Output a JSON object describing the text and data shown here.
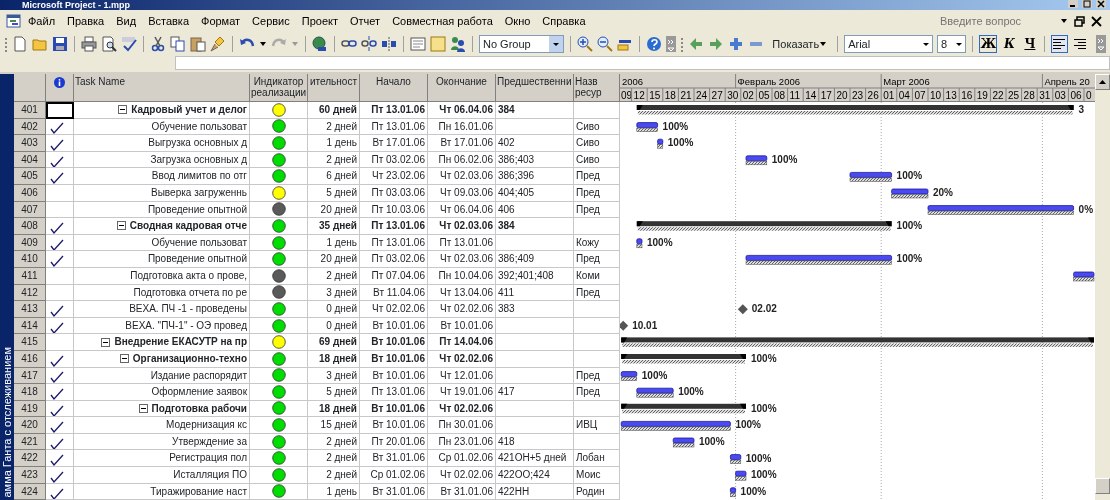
{
  "window": {
    "title": "Microsoft Project - 1.mpp"
  },
  "menu": [
    "Файл",
    "Правка",
    "Вид",
    "Вставка",
    "Формат",
    "Сервис",
    "Проект",
    "Отчет",
    "Совместная работа",
    "Окно",
    "Справка"
  ],
  "help_search": {
    "placeholder": "Введите вопрос"
  },
  "toolbar": {
    "group": "No Group",
    "show_menu": "Показать",
    "font": "Arial",
    "font_size": "8",
    "format_buttons": [
      {
        "label": "Ж",
        "selected": true
      },
      {
        "label": "К",
        "selected": false
      },
      {
        "label": "Ч",
        "selected": false
      }
    ],
    "align_buttons": [
      {
        "selected": true
      },
      {
        "selected": false
      }
    ]
  },
  "view_bar": {
    "label": "амма Ганта с отслеживанием"
  },
  "table": {
    "columns": [
      "Task Name",
      "Индикатор реализации",
      "ительност",
      "Начало",
      "Окончание",
      "Предшественни",
      "Назв ресур"
    ],
    "rows": [
      {
        "id": "401",
        "name": "Кадровый учет и делог",
        "kind": "summary",
        "expanded": true,
        "done": false,
        "selected": true,
        "color": "#ffff00",
        "duration": "60 дней",
        "start": "Пт 13.01.06",
        "finish": "Чт 06.04.06",
        "predecessors": "384",
        "bar_label": "3"
      },
      {
        "id": "402",
        "name": "Обучение пользоват",
        "kind": "task",
        "done": true,
        "selected": false,
        "color": "#00dd00",
        "duration": "2 дней",
        "start": "Пт 13.01.06",
        "finish": "Пн 16.01.06",
        "resource": "Сиво",
        "bar_label": "100%"
      },
      {
        "id": "403",
        "name": "Выгрузка основных д",
        "kind": "task",
        "done": true,
        "selected": false,
        "color": "#00dd00",
        "duration": "1 день",
        "start": "Вт 17.01.06",
        "finish": "Вт 17.01.06",
        "predecessors": "402",
        "resource": "Сиво",
        "bar_label": "100%"
      },
      {
        "id": "404",
        "name": "Загрузка основных д",
        "kind": "task",
        "done": true,
        "selected": false,
        "color": "#00dd00",
        "duration": "2 дней",
        "start": "Пт 03.02.06",
        "finish": "Пн 06.02.06",
        "predecessors": "386;403",
        "resource": "Сиво",
        "bar_label": "100%"
      },
      {
        "id": "405",
        "name": "Ввод лимитов по отг",
        "kind": "task",
        "done": true,
        "selected": false,
        "color": "#00dd00",
        "duration": "6 дней",
        "start": "Чт 23.02.06",
        "finish": "Чт 02.03.06",
        "predecessors": "386;396",
        "resource": "Пред",
        "bar_label": "100%"
      },
      {
        "id": "406",
        "name": "Выверка загруженнь",
        "kind": "task",
        "done": false,
        "selected": false,
        "color": "#ffff00",
        "duration": "5 дней",
        "start": "Пт 03.03.06",
        "finish": "Чт 09.03.06",
        "predecessors": "404;405",
        "resource": "Пред",
        "bar_label": "20%"
      },
      {
        "id": "407",
        "name": "Проведение опытной",
        "kind": "task",
        "done": false,
        "selected": false,
        "color": "#5a5a5a",
        "duration": "20 дней",
        "start": "Пт 10.03.06",
        "finish": "Чт 06.04.06",
        "predecessors": "406",
        "resource": "Пред",
        "bar_label": "0%"
      },
      {
        "id": "408",
        "name": "Сводная кадровая отче",
        "kind": "summary",
        "expanded": true,
        "done": true,
        "selected": false,
        "color": "#00dd00",
        "duration": "35 дней",
        "start": "Пт 13.01.06",
        "finish": "Чт 02.03.06",
        "predecessors": "384",
        "bar_label": "100%"
      },
      {
        "id": "409",
        "name": "Обучение пользоват",
        "kind": "task",
        "done": true,
        "selected": false,
        "color": "#00dd00",
        "duration": "1 день",
        "start": "Пт 13.01.06",
        "finish": "Пт 13.01.06",
        "resource": "Кожу",
        "bar_label": "100%"
      },
      {
        "id": "410",
        "name": "Проведение опытной",
        "kind": "task",
        "done": true,
        "selected": false,
        "color": "#00dd00",
        "duration": "20 дней",
        "start": "Пт 03.02.06",
        "finish": "Чт 02.03.06",
        "predecessors": "386;409",
        "resource": "Пред",
        "bar_label": "100%"
      },
      {
        "id": "411",
        "name": "Подготовка акта о прове,",
        "kind": "task",
        "done": false,
        "selected": false,
        "color": "#5a5a5a",
        "duration": "2 дней",
        "start": "Пт 07.04.06",
        "finish": "Пн 10.04.06",
        "predecessors": "392;401;408",
        "resource": "Коми"
      },
      {
        "id": "412",
        "name": "Подготовка отчета по ре",
        "kind": "task",
        "done": false,
        "selected": false,
        "color": "#5a5a5a",
        "duration": "3 дней",
        "start": "Вт 11.04.06",
        "finish": "Чт 13.04.06",
        "predecessors": "411",
        "resource": "Пред"
      },
      {
        "id": "413",
        "name": "ВЕХА. ПЧ -1 - проведены",
        "kind": "milestone",
        "done": true,
        "selected": false,
        "color": "#00dd00",
        "duration": "0 дней",
        "start": "Чт 02.02.06",
        "finish": "Чт 02.02.06",
        "predecessors": "383",
        "bar_label": "02.02"
      },
      {
        "id": "414",
        "name": "ВЕХА. \"ПЧ-1\" - ОЭ провед",
        "kind": "milestone",
        "done": true,
        "selected": false,
        "color": "#00dd00",
        "duration": "0 дней",
        "start": "Вт 10.01.06",
        "finish": "Вт 10.01.06",
        "bar_label": "10.01"
      },
      {
        "id": "415",
        "name": "Внедрение ЕКАСУТР на пр",
        "kind": "summary",
        "expanded": true,
        "done": false,
        "selected": false,
        "color": "#ffff00",
        "duration": "69 дней",
        "start": "Вт 10.01.06",
        "finish": "Пт 14.04.06"
      },
      {
        "id": "416",
        "name": "Организационно-техно",
        "kind": "summary",
        "expanded": true,
        "done": true,
        "selected": false,
        "color": "#00dd00",
        "duration": "18 дней",
        "start": "Вт 10.01.06",
        "finish": "Чт 02.02.06",
        "bar_label": "100%"
      },
      {
        "id": "417",
        "name": "Издание распорядит",
        "kind": "task",
        "done": true,
        "selected": false,
        "color": "#00dd00",
        "duration": "3 дней",
        "start": "Вт 10.01.06",
        "finish": "Чт 12.01.06",
        "resource": "Пред",
        "bar_label": "100%"
      },
      {
        "id": "418",
        "name": "Оформление заявок",
        "kind": "task",
        "done": true,
        "selected": false,
        "color": "#00dd00",
        "duration": "5 дней",
        "start": "Пт 13.01.06",
        "finish": "Чт 19.01.06",
        "predecessors": "417",
        "resource": "Пред",
        "bar_label": "100%"
      },
      {
        "id": "419",
        "name": "Подготовка рабочи",
        "kind": "summary",
        "expanded": true,
        "done": true,
        "selected": false,
        "color": "#00dd00",
        "duration": "18 дней",
        "start": "Вт 10.01.06",
        "finish": "Чт 02.02.06",
        "bar_label": "100%"
      },
      {
        "id": "420",
        "name": "Модернизация кс",
        "kind": "task",
        "done": true,
        "selected": false,
        "color": "#00dd00",
        "duration": "15 дней",
        "start": "Вт 10.01.06",
        "finish": "Пн 30.01.06",
        "resource": "ИВЦ",
        "bar_label": "100%"
      },
      {
        "id": "421",
        "name": "Утверждение за",
        "kind": "task",
        "done": true,
        "selected": false,
        "color": "#00dd00",
        "duration": "2 дней",
        "start": "Пт 20.01.06",
        "finish": "Пн 23.01.06",
        "predecessors": "418",
        "bar_label": "100%"
      },
      {
        "id": "422",
        "name": "Регистрация пол",
        "kind": "task",
        "done": true,
        "selected": false,
        "color": "#00dd00",
        "duration": "2 дней",
        "start": "Вт 31.01.06",
        "finish": "Ср 01.02.06",
        "predecessors": "421ОН+5 дней",
        "resource": "Лобан",
        "bar_label": "100%"
      },
      {
        "id": "423",
        "name": "Исталляция ПО",
        "kind": "task",
        "done": true,
        "selected": false,
        "color": "#00dd00",
        "duration": "2 дней",
        "start": "Ср 01.02.06",
        "finish": "Чт 02.02.06",
        "predecessors": "422ОО;424",
        "resource": "Моис",
        "bar_label": "100%"
      },
      {
        "id": "424",
        "name": "Тиражирование наст",
        "kind": "task",
        "done": true,
        "selected": false,
        "color": "#00dd00",
        "duration": "1 день",
        "start": "Вт 31.01.06",
        "finish": "Вт 31.01.06",
        "predecessors": "422НН",
        "resource": "Родин",
        "bar_label": "100%"
      }
    ]
  },
  "gantt": {
    "months": [
      "2006",
      "Февраль 2006",
      "Март 2006",
      "Апрель 20"
    ],
    "days": [
      "09",
      "12",
      "15",
      "18",
      "21",
      "24",
      "27",
      "30",
      "02",
      "05",
      "08",
      "11",
      "14",
      "17",
      "20",
      "23",
      "26",
      "01",
      "04",
      "07",
      "10",
      "13",
      "16",
      "19",
      "22",
      "25",
      "28",
      "31",
      "03",
      "06",
      "0"
    ]
  }
}
